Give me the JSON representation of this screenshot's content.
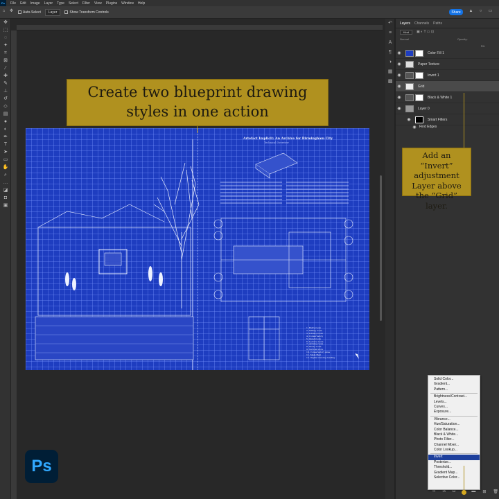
{
  "menubar": {
    "items": [
      "File",
      "Edit",
      "Image",
      "Layer",
      "Type",
      "Select",
      "Filter",
      "View",
      "Plugins",
      "Window",
      "Help"
    ]
  },
  "options_bar": {
    "auto_select_label": "Auto-Select",
    "auto_select_value": "Layer",
    "show_transform_label": "Show Transform Controls",
    "share_label": "Share"
  },
  "layers_panel": {
    "tabs": [
      "Layers",
      "Channels",
      "Paths"
    ],
    "filter_label": "Kind",
    "blend_mode": "Normal",
    "opacity_label": "Opacity:",
    "fill_label": "Fill:",
    "layers": [
      {
        "name": "Color Fill 1",
        "selected": false
      },
      {
        "name": "Paper Texture",
        "selected": false
      },
      {
        "name": "Invert 1",
        "selected": false
      },
      {
        "name": "Grid",
        "selected": true
      },
      {
        "name": "Black & White 1",
        "selected": false
      },
      {
        "name": "Layer 0",
        "selected": false
      },
      {
        "name": "Smart Filters",
        "selected": false
      },
      {
        "name": "Find Edges",
        "selected": false
      }
    ]
  },
  "callouts": {
    "main_title": "Create two blueprint drawing styles in one action",
    "side_note": "Add an “Invert” adjustment Layer above the “Grid” layer."
  },
  "adjustment_menu": {
    "groups": [
      [
        "Solid Color...",
        "Gradient...",
        "Pattern..."
      ],
      [
        "Brightness/Contrast...",
        "Levels...",
        "Curves...",
        "Exposure..."
      ],
      [
        "Vibrance...",
        "Hue/Saturation...",
        "Color Balance...",
        "Black & White...",
        "Photo Filter...",
        "Channel Mixer...",
        "Color Lookup..."
      ],
      [
        "Invert",
        "Posterize...",
        "Threshold...",
        "Gradient Map...",
        "Selective Color..."
      ]
    ],
    "active_item": "Invert"
  },
  "canvas": {
    "doc_title": "Artefact Implicit: An Archive for Birmingham City",
    "doc_subtitle": "Technical Overview",
    "list_items": [
      "1. Entry room",
      "2. Sitting room",
      "3. Library room",
      "4. Conservatory",
      "5. Quiet room",
      "6. Lecture room",
      "7. Archive room",
      "8. Study room",
      "9. Vertical store",
      "10. Conservatory area",
      "11. Main Hall",
      "12. Digital viewing reading"
    ]
  },
  "colors": {
    "canvas_blue": "#1e3dc0",
    "callout_gold": "#b0911f",
    "menu_highlight": "#1d3f9c"
  },
  "logo": {
    "text": "Ps"
  }
}
